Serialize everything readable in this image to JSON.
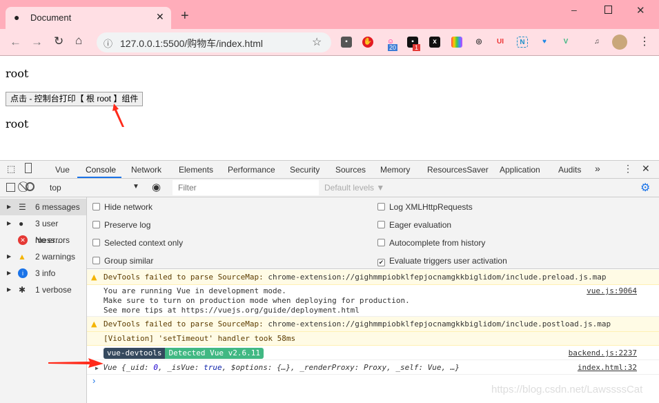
{
  "browser": {
    "tab_title": "Document",
    "url": "127.0.0.1:5500/购物车/index.html",
    "ext_badges": [
      "20",
      "1"
    ]
  },
  "page": {
    "line1": "root",
    "button": "点击 - 控制台打印【 根 root 】组件",
    "line2": "root"
  },
  "devtools": {
    "tabs": [
      "Vue",
      "Console",
      "Network",
      "Elements",
      "Performance",
      "Security",
      "Sources",
      "Memory",
      "ResourcesSaver",
      "Application",
      "Audits"
    ],
    "active_tab": "Console",
    "context": "top",
    "filter_placeholder": "Filter",
    "levels": "Default levels ▼",
    "sidebar": [
      {
        "label": "6 messages",
        "icon": "list-icon"
      },
      {
        "label": "3 user mess...",
        "icon": "user-icon"
      },
      {
        "label": "No errors",
        "icon": "error-icon"
      },
      {
        "label": "2 warnings",
        "icon": "warning-icon"
      },
      {
        "label": "3 info",
        "icon": "info-icon"
      },
      {
        "label": "1 verbose",
        "icon": "bug-icon"
      }
    ],
    "settings_left": [
      {
        "label": "Hide network",
        "checked": false
      },
      {
        "label": "Preserve log",
        "checked": false
      },
      {
        "label": "Selected context only",
        "checked": false
      },
      {
        "label": "Group similar",
        "checked": false
      }
    ],
    "settings_right": [
      {
        "label": "Log XMLHttpRequests",
        "checked": false
      },
      {
        "label": "Eager evaluation",
        "checked": false
      },
      {
        "label": "Autocomplete from history",
        "checked": false
      },
      {
        "label": "Evaluate triggers user activation",
        "checked": true
      }
    ],
    "messages": {
      "w1_text": "DevTools failed to parse SourceMap: ",
      "w1_link": "chrome-extension://gighmmpiobklfepjocnamgkkbiglidom/include.preload.js.map",
      "i1_l1": "You are running Vue in development mode.",
      "i1_l2": "Make sure to turn on production mode when deploying for production.",
      "i1_l3": "See more tips at ",
      "i1_link": "https://vuejs.org/guide/deployment.html",
      "i1_src": "vue.js:9064",
      "w2_text": "DevTools failed to parse SourceMap: ",
      "w2_link": "chrome-extension://gighmmpiobklfepjocnamgkkbiglidom/include.postload.js.map",
      "v_text": "[Violation] 'setTimeout' handler took 58ms",
      "badge1": "vue-devtools",
      "badge2": "Detected Vue v2.6.11",
      "b_src": "backend.js:2237",
      "obj_a": "Vue {_uid: ",
      "obj_0": "0",
      "obj_b": ", _isVue: ",
      "obj_true": "true",
      "obj_c": ", $options: {…}, _renderProxy: Proxy, _self: Vue, …}",
      "obj_src": "index.html:32"
    }
  },
  "watermark": "https://blog.csdn.net/LawssssCat",
  "colors": {
    "tabbar": "#ffadba",
    "toolbar": "#ffdfe4",
    "accent": "#1a73e8",
    "badge_dark": "#35495e",
    "badge_green": "#41b883",
    "arrow": "#ff2a1a"
  }
}
